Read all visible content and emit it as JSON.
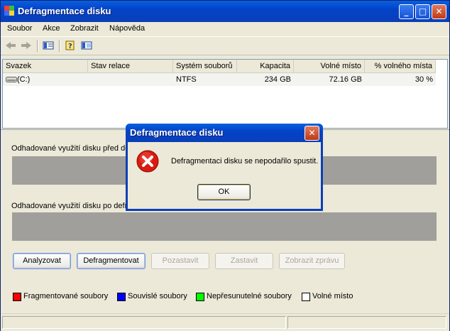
{
  "window": {
    "title": "Defragmentace disku"
  },
  "menu": [
    "Soubor",
    "Akce",
    "Zobrazit",
    "Nápověda"
  ],
  "toolbar": {
    "icons": [
      "back-arrow-icon",
      "forward-arrow-icon",
      "volume-list-icon",
      "help-icon",
      "properties-icon"
    ]
  },
  "volumes": {
    "columns": [
      "Svazek",
      "Stav relace",
      "Systém souborů",
      "Kapacita",
      "Volné místo",
      "% volného místa"
    ],
    "rows": [
      {
        "name": "(C:)",
        "status": "",
        "filesystem": "NTFS",
        "capacity": "234 GB",
        "free": "72.16 GB",
        "free_pct": "30 %"
      }
    ]
  },
  "panel": {
    "before_label": "Odhadované využití disku před defragmentací:",
    "after_label": "Odhadované využití disku po defragmentaci:"
  },
  "buttons": {
    "analyze": "Analyzovat",
    "defrag": "Defragmentovat",
    "pause": "Pozastavit",
    "stop": "Zastavit",
    "report": "Zobrazit zprávu"
  },
  "legend": [
    {
      "label": "Fragmentované soubory",
      "color": "#ff0000"
    },
    {
      "label": "Souvislé soubory",
      "color": "#0000ff"
    },
    {
      "label": "Nepřesunutelné soubory",
      "color": "#00ff00"
    },
    {
      "label": "Volné místo",
      "color": "#ffffff"
    }
  ],
  "dialog": {
    "title": "Defragmentace disku",
    "message": "Defragmentaci disku se nepodařilo spustit.",
    "ok": "OK"
  }
}
